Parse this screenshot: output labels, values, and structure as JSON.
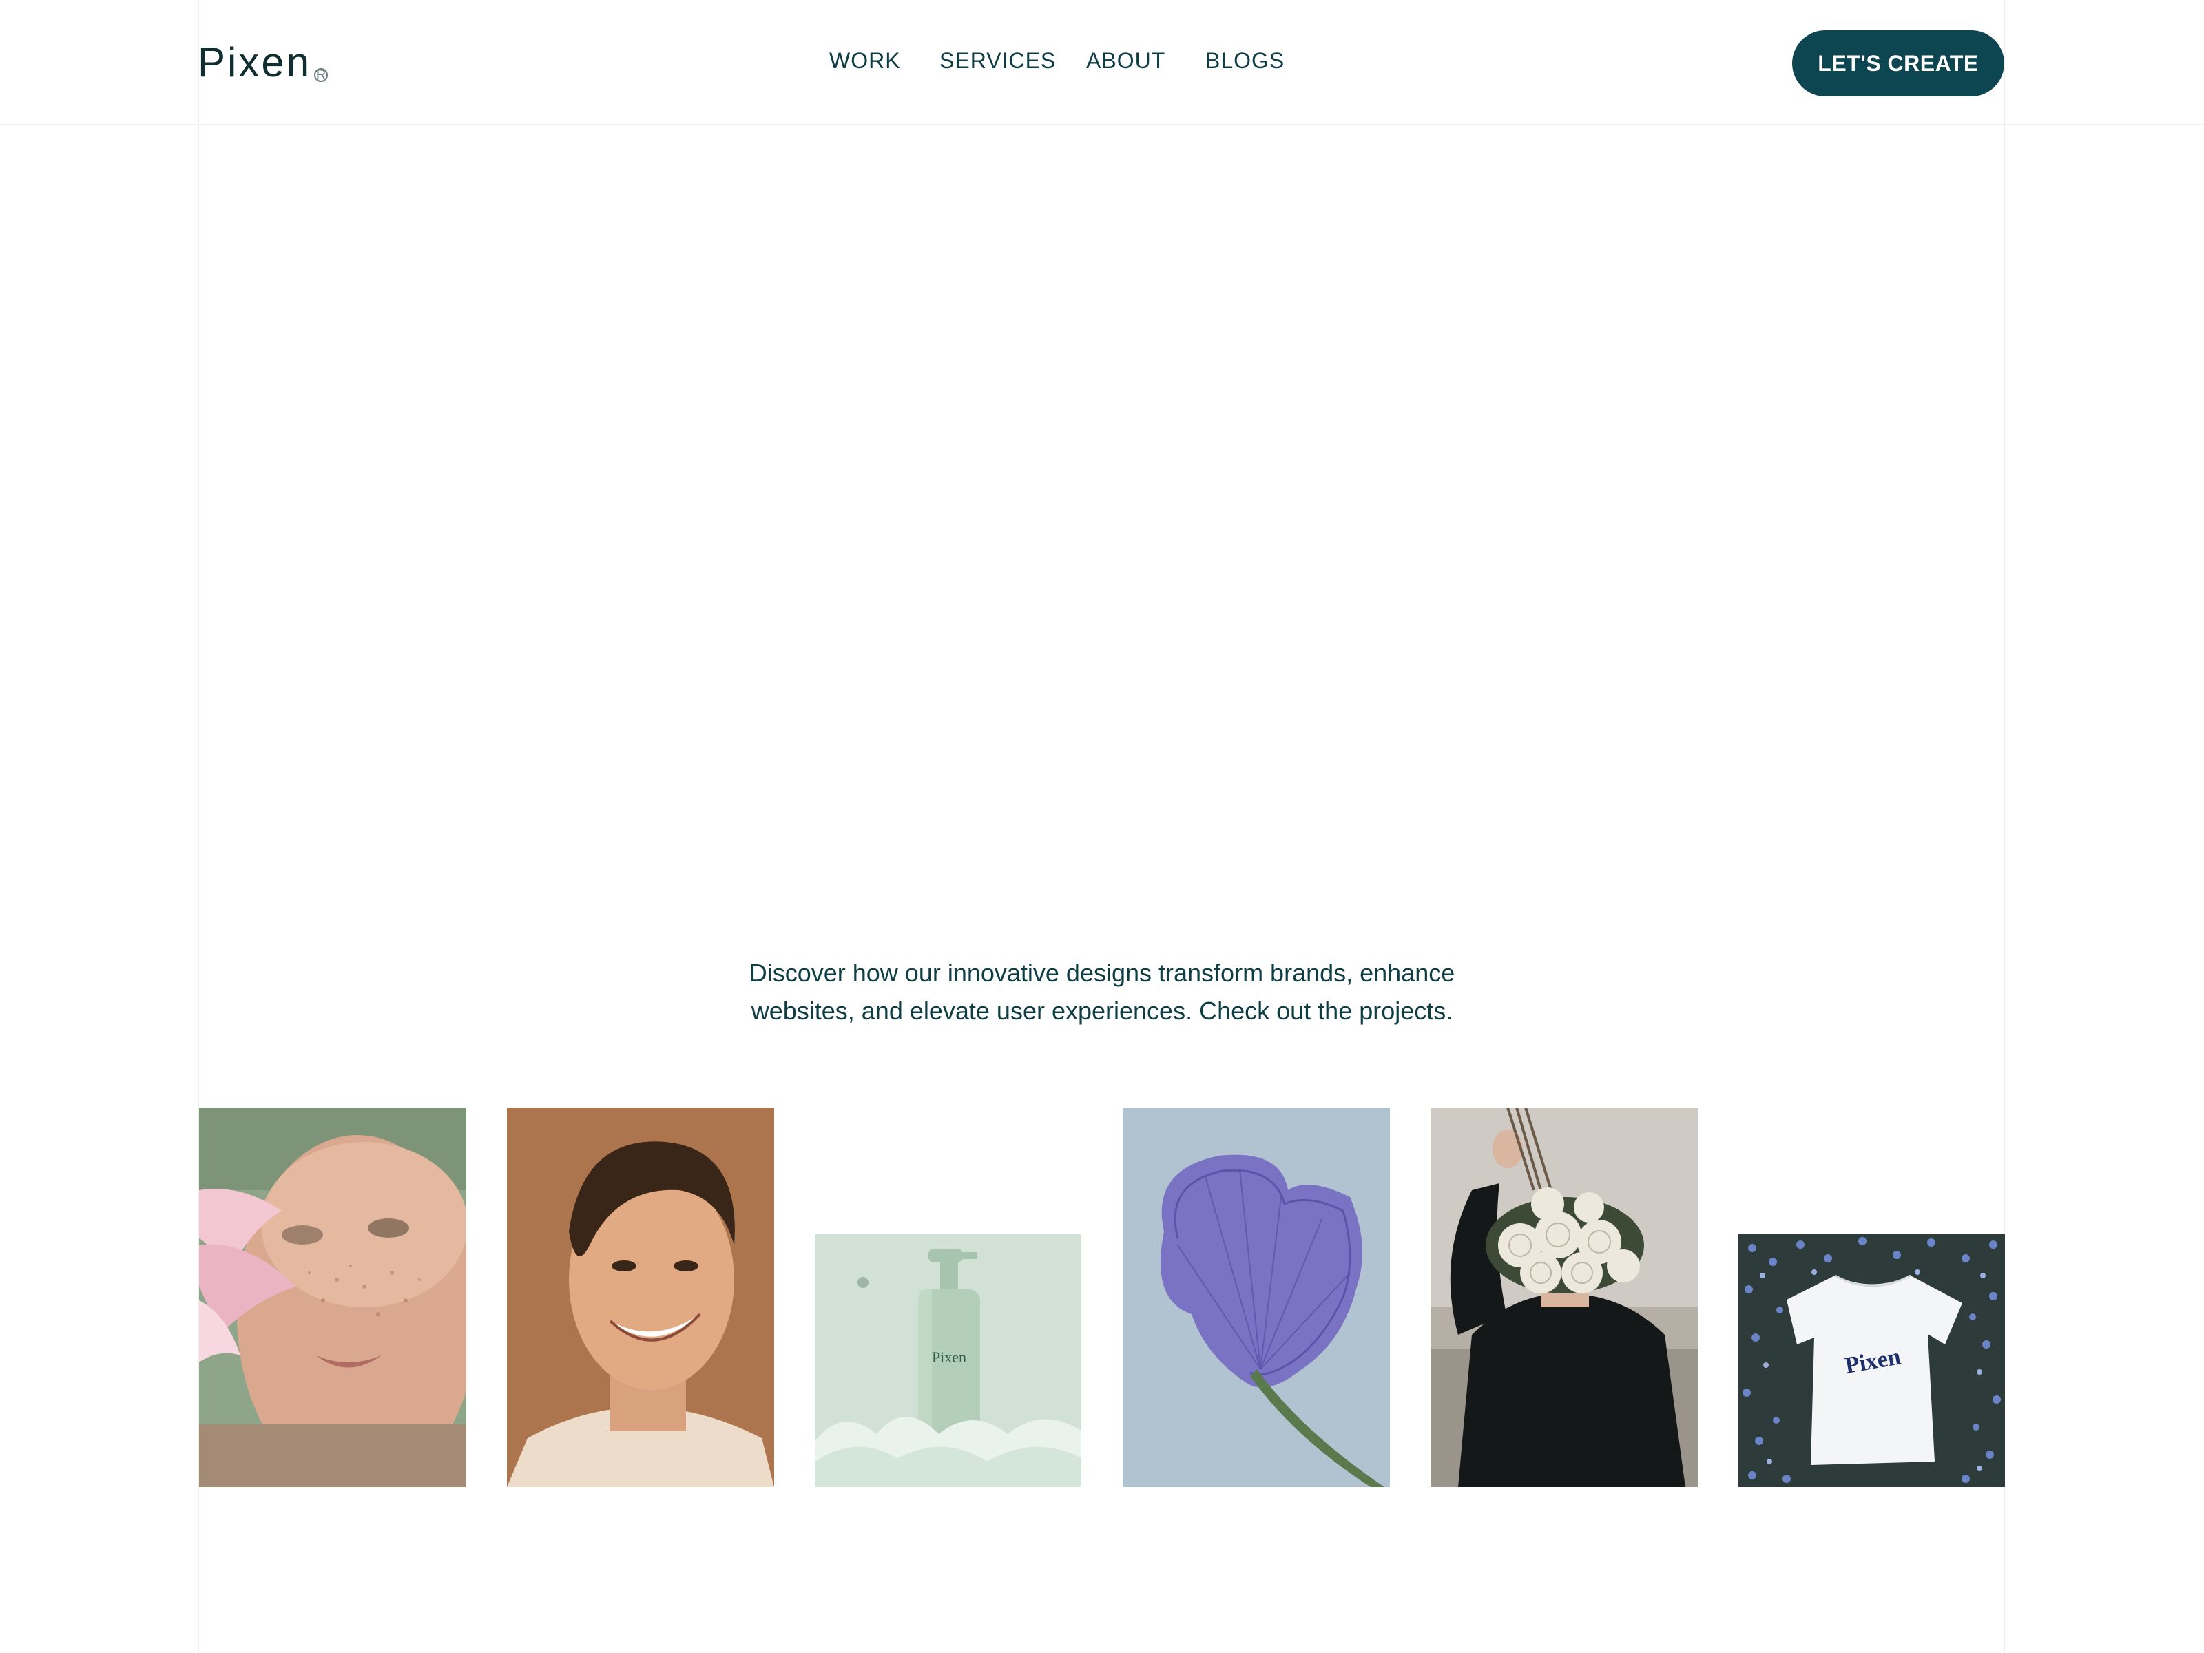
{
  "brand": {
    "name": "Pixen",
    "mark": "R"
  },
  "nav": {
    "items": [
      "WORK",
      "SERVICES",
      "ABOUT",
      "BLOGS"
    ]
  },
  "cta": {
    "label": "LET'S CREATE"
  },
  "intro": {
    "line1": "Discover how our innovative designs transform brands, enhance",
    "line2": "websites, and elevate user experiences. Check out the projects."
  },
  "gallery": {
    "bottle_label": "Pixen",
    "shirt_label": "Pixen",
    "images": [
      "freckled-face-with-lily",
      "smiling-curly-haired-man",
      "green-bottle-in-foam",
      "purple-iris-petal",
      "person-with-rose-bouquet",
      "pixen-tshirt-on-flowers"
    ]
  },
  "colors": {
    "accent": "#0d4550",
    "text": "#0e3d44",
    "background": "#ffffff",
    "guide": "#eef0f0"
  }
}
